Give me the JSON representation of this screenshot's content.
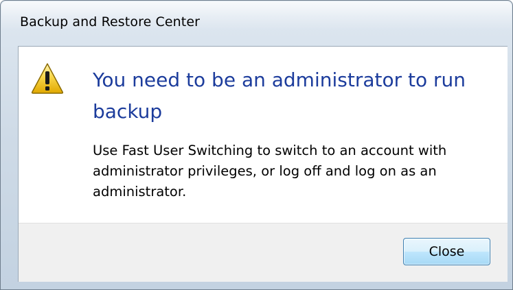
{
  "window": {
    "title": "Backup and Restore Center"
  },
  "dialog": {
    "icon": "warning-icon",
    "headline": "You need to be an administrator to run backup",
    "message": "Use Fast User Switching to switch to an account with administrator privileges, or log off and log on as an administrator."
  },
  "footer": {
    "close_label": "Close"
  },
  "colors": {
    "headline": "#1c3c9c",
    "warning_fill": "#f9d649",
    "button_border": "#3c7fb1"
  }
}
